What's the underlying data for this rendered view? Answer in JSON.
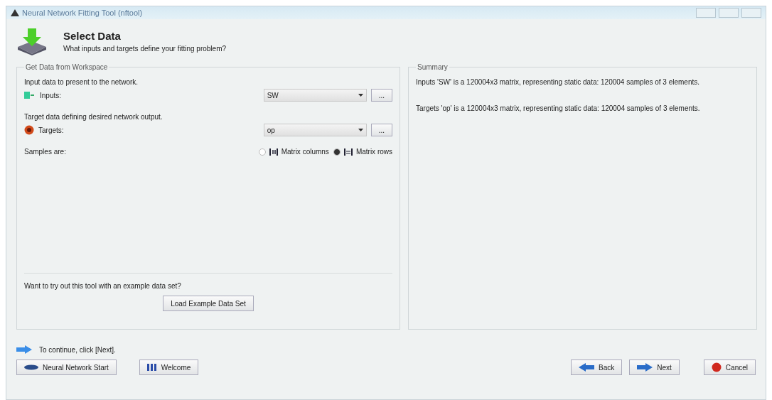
{
  "window": {
    "title": "Neural Network Fitting Tool (nftool)"
  },
  "header": {
    "title": "Select Data",
    "subtitle": "What inputs and targets define your fitting problem?"
  },
  "workspace": {
    "legend": "Get Data from Workspace",
    "fields": [
      {
        "kind": "inputs",
        "hint": "Input data to present to the network.",
        "label": "Inputs:",
        "value": "SW",
        "browse": "..."
      },
      {
        "kind": "targets",
        "hint": "Target data defining desired network output.",
        "label": "Targets:",
        "value": "op",
        "browse": "..."
      }
    ],
    "samples": {
      "label": "Samples are:",
      "options": [
        {
          "kind": "columns",
          "label": "Matrix columns",
          "selected": false
        },
        {
          "kind": "rows",
          "label": "Matrix rows",
          "selected": true
        }
      ]
    },
    "example": {
      "prompt": "Want to try out this tool with an example data set?",
      "button": "Load Example Data Set"
    }
  },
  "summary": {
    "legend": "Summary",
    "lines": [
      "Inputs 'SW' is a 120004x3 matrix, representing static data: 120004 samples of 3 elements.",
      "Targets 'op' is a 120004x3 matrix, representing static data: 120004 samples of 3 elements."
    ]
  },
  "hint": "To continue, click [Next].",
  "buttons": [
    {
      "kind": "start",
      "label": "Neural Network Start"
    },
    {
      "kind": "welcome",
      "label": "Welcome"
    },
    {
      "kind": "back",
      "label": "Back"
    },
    {
      "kind": "next",
      "label": "Next"
    },
    {
      "kind": "cancel",
      "label": "Cancel"
    }
  ]
}
